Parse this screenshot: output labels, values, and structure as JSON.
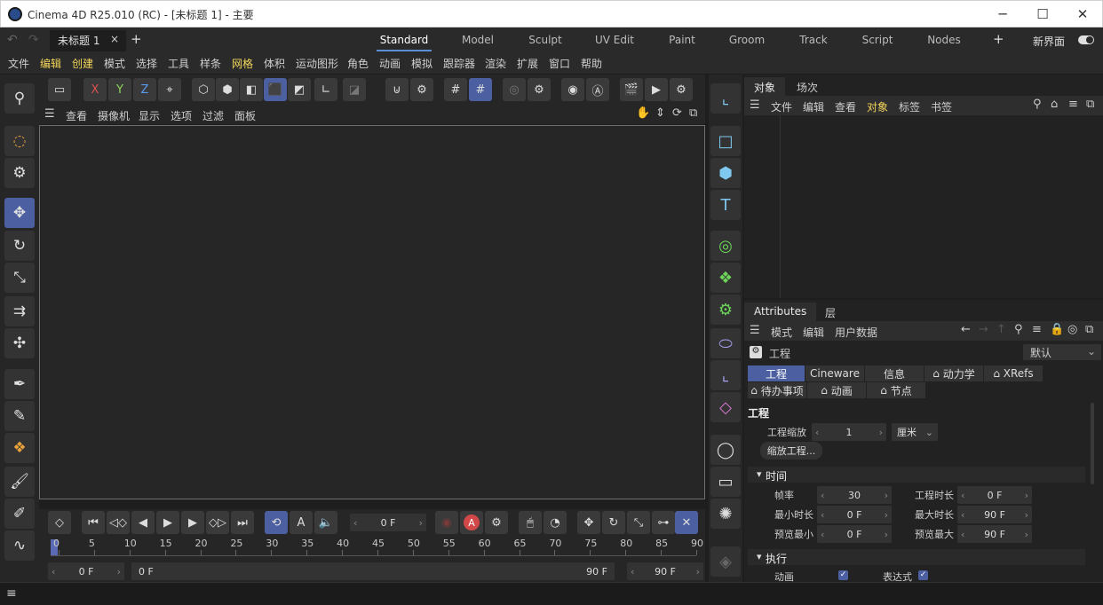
{
  "titlebar": {
    "title": "Cinema 4D R25.010 (RC) - [未标题 1] - 主要",
    "minimize": "─",
    "maximize": "☐",
    "close": "✕"
  },
  "tabbar": {
    "doc_tab": "未标题 1",
    "close": "×",
    "add": "+",
    "layouts": [
      "Standard",
      "Model",
      "Sculpt",
      "UV Edit",
      "Paint",
      "Groom",
      "Track",
      "Script",
      "Nodes"
    ],
    "add_layout": "+",
    "new_ui": "新界面"
  },
  "menubar": [
    "文件",
    "编辑",
    "创建",
    "模式",
    "选择",
    "工具",
    "样条",
    "网格",
    "体积",
    "运动图形",
    "角色",
    "动画",
    "模拟",
    "跟踪器",
    "渲染",
    "扩展",
    "窗口",
    "帮助"
  ],
  "toptools": {
    "x": "X",
    "y": "Y",
    "z": "Z"
  },
  "viewport_menu": [
    "查看",
    "摄像机",
    "显示",
    "选项",
    "过滤",
    "面板"
  ],
  "playbar": {
    "frame": "0 F"
  },
  "timeline": {
    "ticks": [
      "0",
      "5",
      "10",
      "15",
      "20",
      "25",
      "30",
      "35",
      "40",
      "45",
      "50",
      "55",
      "60",
      "65",
      "70",
      "75",
      "80",
      "85",
      "90"
    ]
  },
  "rangebar": {
    "start": "0 F",
    "range_start": "0 F",
    "range_end": "90 F",
    "end": "90 F"
  },
  "object_panel": {
    "tabs": [
      "对象",
      "场次"
    ],
    "menu": [
      "文件",
      "编辑",
      "查看",
      "对象",
      "标签",
      "书签"
    ]
  },
  "attr_panel": {
    "tabs": [
      "Attributes",
      "层"
    ],
    "menu": [
      "模式",
      "编辑",
      "用户数据"
    ],
    "header": "工程",
    "preset": "默认",
    "seg_row1": [
      "工程",
      "Cineware",
      "信息",
      "动力学",
      "XRefs"
    ],
    "seg_row2": [
      "待办事项",
      "动画",
      "节点"
    ],
    "section": "工程",
    "scale_label": "工程缩放",
    "scale_value": "1",
    "scale_unit": "厘米",
    "scale_btn": "缩放工程...",
    "time_group": "时间",
    "fps_label": "帧率",
    "fps": "30",
    "duration_label": "工程时长",
    "duration": "0 F",
    "min_label": "最小时长",
    "min": "0 F",
    "max_label": "最大时长",
    "max": "90 F",
    "pmin_label": "预览最小",
    "pmin": "0 F",
    "pmax_label": "预览最大",
    "pmax": "90 F",
    "exec_group": "执行",
    "anim_label": "动画",
    "expr_label": "表达式"
  },
  "status": "≡"
}
